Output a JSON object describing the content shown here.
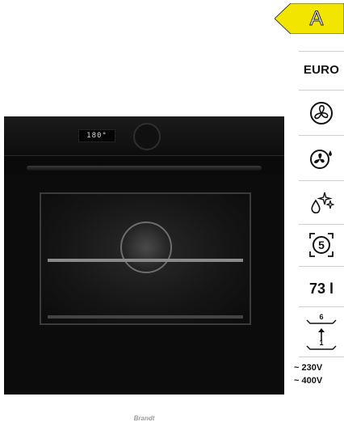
{
  "oven": {
    "display_time": "180°",
    "brand": "Brandt"
  },
  "specs": {
    "energy_class": "A",
    "energy_color": "#f2e600",
    "standard": "EURO",
    "icons": [
      "convection-fan-icon",
      "fan-steam-icon",
      "steam-clean-icon",
      "cooking-levels-5-icon"
    ],
    "cooking_levels": "5",
    "volume": "73 l",
    "shelf_positions": {
      "top": "6",
      "bottom": "1"
    },
    "voltage": [
      "~ 230V",
      "~ 400V"
    ]
  }
}
